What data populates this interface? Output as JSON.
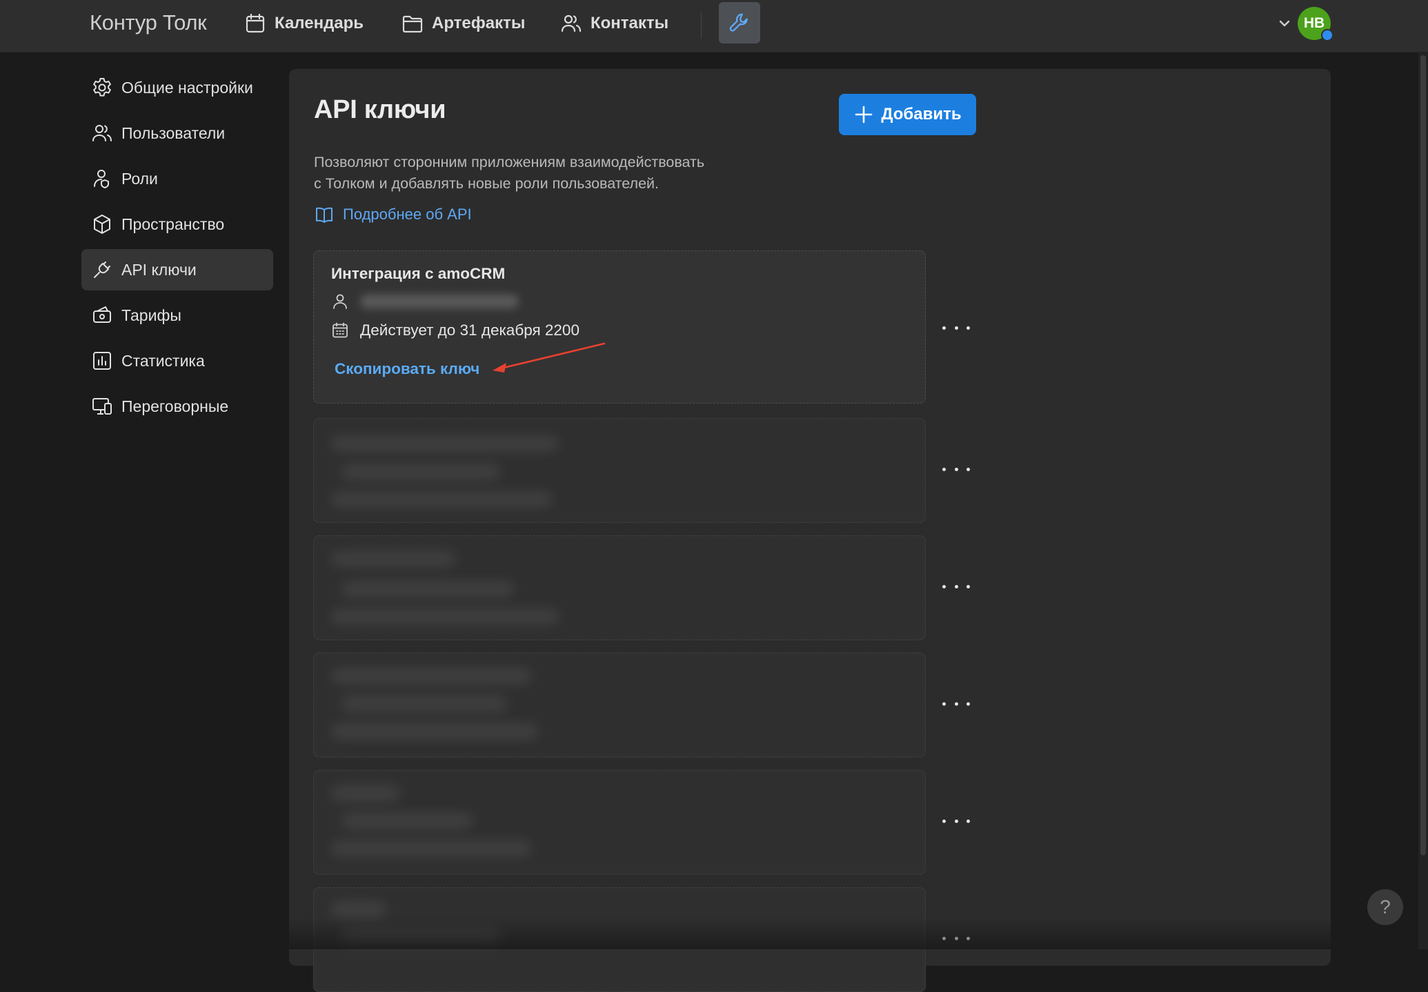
{
  "app": {
    "logo": "Контур Толк"
  },
  "nav": {
    "calendar": "Календарь",
    "artifacts": "Артефакты",
    "contacts": "Контакты"
  },
  "user": {
    "initials": "НВ",
    "avatar_color": "#4ca21b"
  },
  "sidebar": {
    "items": [
      {
        "label": "Общие настройки",
        "icon": "gear-icon"
      },
      {
        "label": "Пользователи",
        "icon": "users-icon"
      },
      {
        "label": "Роли",
        "icon": "roles-icon"
      },
      {
        "label": "Пространство",
        "icon": "cube-icon"
      },
      {
        "label": "API ключи",
        "icon": "plug-icon",
        "active": true
      },
      {
        "label": "Тарифы",
        "icon": "tariff-icon"
      },
      {
        "label": "Статистика",
        "icon": "stats-icon"
      },
      {
        "label": "Переговорные",
        "icon": "devices-icon"
      }
    ]
  },
  "main": {
    "title": "API ключи",
    "add_label": "Добавить",
    "description_line1": "Позволяют сторонним приложениям взаимодействовать",
    "description_line2": "с Толком и добавлять новые роли пользователей.",
    "api_link": "Подробнее об API",
    "keys": [
      {
        "name": "Интеграция с amoCRM",
        "valid_until": "Действует до 31 декабря 2200",
        "copy_label": "Скопировать ключ"
      }
    ]
  },
  "help": {
    "label": "?"
  },
  "colors": {
    "accent": "#1c7fe0",
    "link": "#5aaaf5",
    "annotation": "#e8412f"
  }
}
